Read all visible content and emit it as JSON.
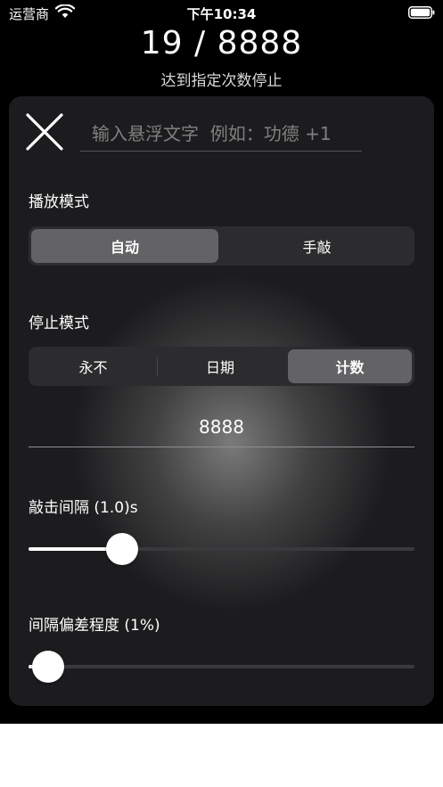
{
  "status_bar": {
    "carrier": "运营商",
    "time": "下午10:34"
  },
  "header": {
    "counter": "19 / 8888",
    "subtitle": "达到指定次数停止"
  },
  "panel": {
    "float_text": {
      "placeholder": "输入悬浮文字  例如：功德 +1",
      "value": ""
    },
    "play_mode": {
      "label": "播放模式",
      "options": [
        "自动",
        "手敲"
      ],
      "selected": "自动"
    },
    "stop_mode": {
      "label": "停止模式",
      "options": [
        "永不",
        "日期",
        "计数"
      ],
      "selected": "计数",
      "count_value": "8888"
    },
    "tap_interval": {
      "label": "敲击间隔 (1.0)s",
      "level": 0.22
    },
    "interval_deviation": {
      "label": "间隔偏差程度 (1%)",
      "level": 0.01
    }
  },
  "icons": {
    "close": "close-icon",
    "wifi": "wifi-icon",
    "battery": "battery-icon"
  },
  "colors": {
    "background": "#000000",
    "panel": "#1c1c1e",
    "segment_active": "#636366",
    "track": "#3a3a3c"
  }
}
